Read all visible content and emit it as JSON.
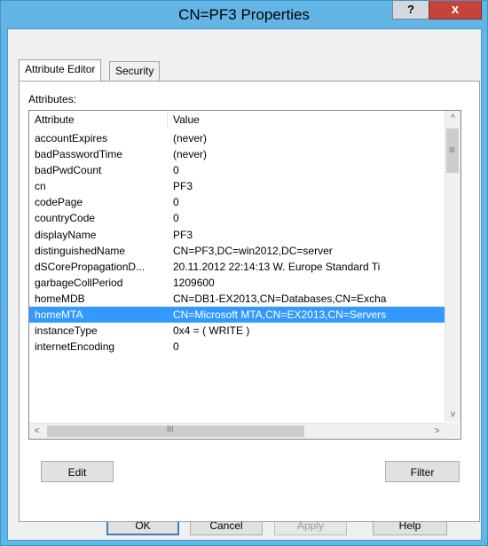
{
  "window": {
    "title": "CN=PF3 Properties",
    "help_glyph": "?",
    "close_glyph": "x"
  },
  "tabs": [
    {
      "label": "Attribute Editor",
      "active": true
    },
    {
      "label": "Security",
      "active": false
    }
  ],
  "attributes_label": "Attributes:",
  "list": {
    "columns": [
      "Attribute",
      "Value"
    ],
    "rows": [
      {
        "attr": "accountExpires",
        "value": "(never)"
      },
      {
        "attr": "badPasswordTime",
        "value": "(never)"
      },
      {
        "attr": "badPwdCount",
        "value": "0"
      },
      {
        "attr": "cn",
        "value": "PF3"
      },
      {
        "attr": "codePage",
        "value": "0"
      },
      {
        "attr": "countryCode",
        "value": "0"
      },
      {
        "attr": "displayName",
        "value": "PF3"
      },
      {
        "attr": "distinguishedName",
        "value": "CN=PF3,DC=win2012,DC=server"
      },
      {
        "attr": "dSCorePropagationD...",
        "value": "20.11.2012 22:14:13 W. Europe Standard Ti"
      },
      {
        "attr": "garbageCollPeriod",
        "value": "1209600"
      },
      {
        "attr": "homeMDB",
        "value": "CN=DB1-EX2013,CN=Databases,CN=Excha"
      },
      {
        "attr": "homeMTA",
        "value": "CN=Microsoft MTA,CN=EX2013,CN=Servers",
        "selected": true
      },
      {
        "attr": "instanceType",
        "value": "0x4 = ( WRITE )"
      },
      {
        "attr": "internetEncoding",
        "value": "0"
      }
    ]
  },
  "scroll": {
    "up": "^",
    "down": "v",
    "left": "<",
    "right": ">",
    "v_grip": "≡",
    "h_grip": "III"
  },
  "buttons": {
    "edit": "Edit",
    "filter": "Filter",
    "ok": "OK",
    "cancel": "Cancel",
    "apply": "Apply",
    "help": "Help"
  },
  "colors": {
    "title_bar": "#62b5e5",
    "close": "#c7433a",
    "selection": "#3399ff"
  }
}
